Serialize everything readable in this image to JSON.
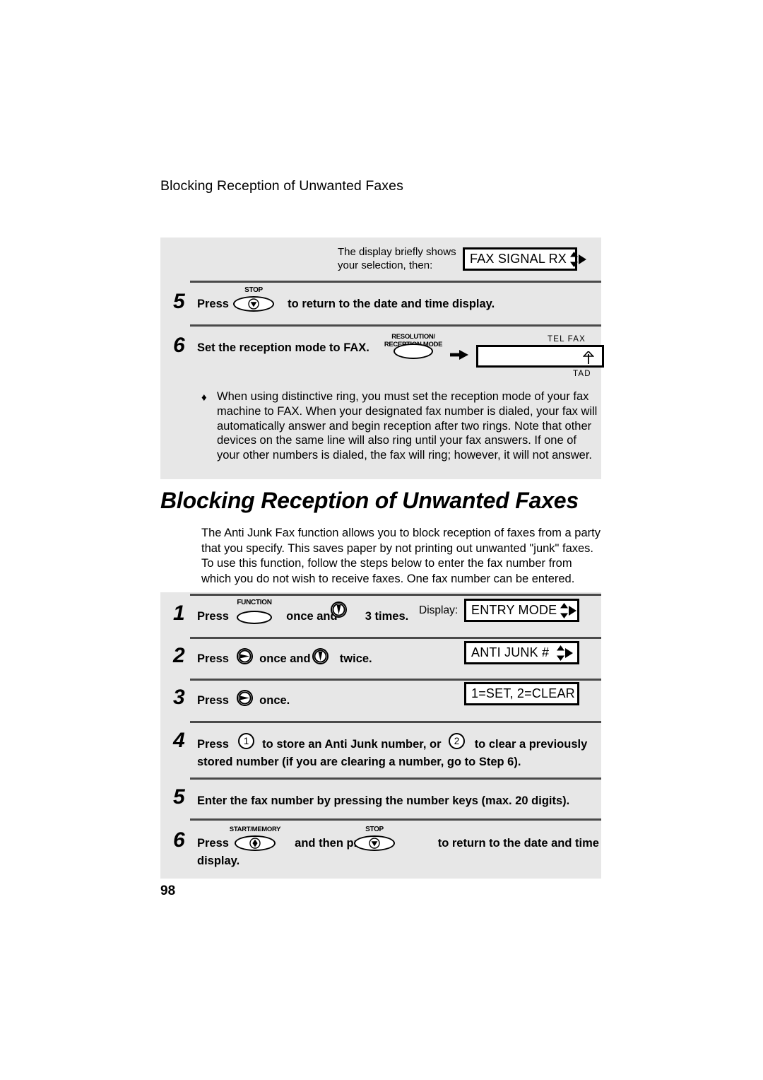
{
  "page": {
    "running_head": "Blocking Reception of Unwanted Faxes",
    "page_number": "98"
  },
  "top_panel": {
    "note": {
      "line1": "The display briefly shows",
      "line2": "your selection, then:"
    },
    "note_display": {
      "text": "FAX SIGNAL RX",
      "arrows_icon": "up-down-right-arrows-icon"
    },
    "steps": [
      {
        "number": "5",
        "press_label": "Press",
        "button": {
          "cap": "STOP",
          "glyph": "stop-circle-icon"
        },
        "text_after": "to return to the date and time display."
      },
      {
        "number": "6",
        "text": "Set the reception mode to FAX.",
        "button": {
          "cap_line1": "RESOLUTION/",
          "cap_line2": "RECEPTION MODE"
        },
        "arrow_icon": "right-arrow-icon",
        "mode_display": {
          "top_labels": "TEL  FAX",
          "bottom_label": "TAD",
          "pointer_icon": "up-arrow-icon"
        }
      }
    ],
    "bullet": {
      "marker": "♦",
      "text": "When using distinctive ring, you must set the reception mode of your fax machine to FAX. When your designated fax number is dialed, your fax will automatically answer and begin reception after two rings. Note that other devices on the same line will also ring until your fax answers. If one of your other numbers is dialed, the fax will ring; however, it will not answer."
    }
  },
  "section": {
    "heading": "Blocking Reception of Unwanted Faxes",
    "intro": "The Anti Junk Fax function allows you to block reception of faxes from a party that you specify. This saves paper by not printing out unwanted \"junk\" faxes. To use this function, follow the steps below to enter the fax number from which you do not wish to receive faxes. One fax number can be entered."
  },
  "main_panel": {
    "display_label": "Display:",
    "steps": [
      {
        "number": "1",
        "press_label": "Press",
        "button": {
          "cap": "FUNCTION"
        },
        "mid_text": "once and",
        "key_icon": "down-arrow-key-icon",
        "end_text": "3 times.",
        "display": {
          "text": "ENTRY MODE",
          "arrows_icon": "up-down-right-arrows-icon"
        }
      },
      {
        "number": "2",
        "press_label": "Press",
        "key_icon_1": "right-arrow-key-icon",
        "mid_text": "once and",
        "key_icon_2": "down-arrow-key-icon",
        "end_text": "twice.",
        "display": {
          "text": "ANTI JUNK #",
          "arrows_icon": "up-down-right-arrows-icon"
        }
      },
      {
        "number": "3",
        "press_label": "Press",
        "key_icon": "right-arrow-key-icon",
        "end_text": "once.",
        "display": {
          "text": "1=SET, 2=CLEAR"
        }
      },
      {
        "number": "4",
        "press_label": "Press",
        "key_1": "1",
        "text_a": "to store an Anti Junk number, or",
        "key_2": "2",
        "text_b": "to clear a previously",
        "line2": "stored number (if you are clearing a number, go to Step 6)."
      },
      {
        "number": "5",
        "text": "Enter the fax number by pressing the number keys (max. 20 digits)."
      },
      {
        "number": "6",
        "press_label": "Press",
        "button_1": {
          "cap": "START/MEMORY",
          "glyph": "start-diamond-icon"
        },
        "mid_text": "and then press",
        "button_2": {
          "cap": "STOP",
          "glyph": "stop-circle-icon"
        },
        "end_text": "to return to the date and time",
        "line2": "display."
      }
    ]
  },
  "colors": {
    "panel_background": "#e7e7e7",
    "rule": "#4a4a4a",
    "ink": "#000000",
    "paper": "#ffffff"
  }
}
